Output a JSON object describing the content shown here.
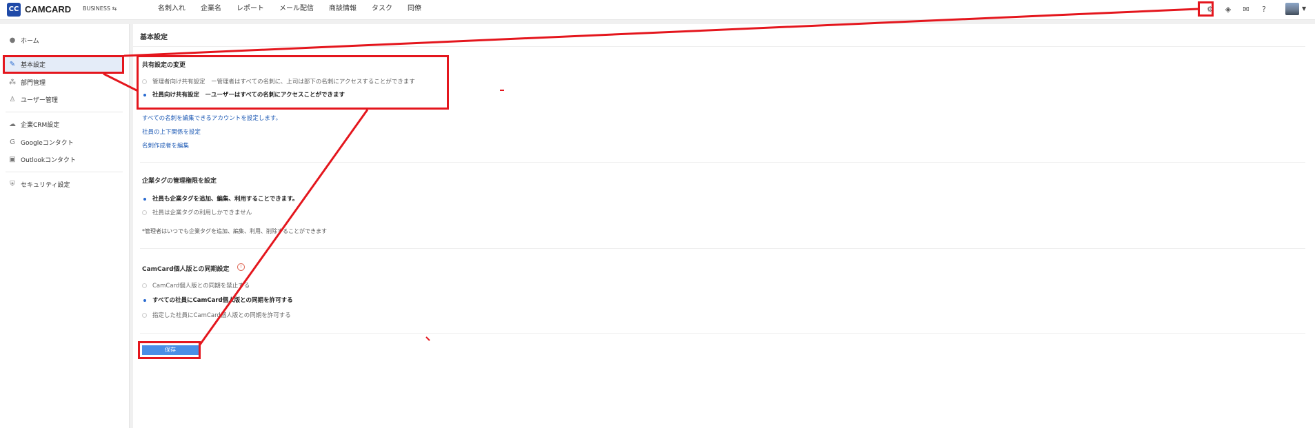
{
  "header": {
    "logo_mark": "CC",
    "logo_text": "CAMCARD",
    "edition": "BUSINESS ⇆",
    "nav": [
      "名刺入れ",
      "企業名",
      "レポート",
      "メール配信",
      "商談情報",
      "タスク",
      "同僚"
    ]
  },
  "sidebar": {
    "items": [
      {
        "label": "ホーム",
        "icon": "info-icon"
      },
      {
        "label": "基本設定",
        "icon": "wrench-icon",
        "active": true
      },
      {
        "label": "部門管理",
        "icon": "org-chart-icon"
      },
      {
        "label": "ユーザー管理",
        "icon": "user-icon"
      },
      {
        "label": "企業CRM設定",
        "icon": "cloud-icon"
      },
      {
        "label": "Googleコンタクト",
        "icon": "google-icon"
      },
      {
        "label": "Outlookコンタクト",
        "icon": "outlook-icon"
      },
      {
        "label": "セキュリティ設定",
        "icon": "shield-icon"
      }
    ]
  },
  "main": {
    "title": "基本設定",
    "sharing": {
      "title": "共有設定の変更",
      "option_admin": "管理者向け共有設定　ー管理者はすべての名刺に、上司は部下の名刺にアクセスすることができます",
      "option_employee": "社員向け共有設定　ーユーザーはすべての名刺にアクセスことができます",
      "selected": "employee",
      "links": [
        "すべての名刺を編集できるアカウントを設定します。",
        "社員の上下関係を設定",
        "名刺作成者を編集"
      ]
    },
    "tags": {
      "title": "企業タグの管理権限を設定",
      "option_allow": "社員も企業タグを追加、編集、利用することできます。",
      "option_deny": "社員は企業タグの利用しかできません",
      "selected": "allow",
      "note": "*管理者はいつでも企業タグを追加、編集、利用、削除することができます"
    },
    "sync": {
      "title": "CamCard個人版との同期設定",
      "option_forbid": "CamCard個人版との同期を禁止する",
      "option_all": "すべての社員にCamCard個人版との同期を許可する",
      "option_some": "指定した社員にCamCard個人版との同期を許可する",
      "selected": "all"
    },
    "save_label": "保存"
  },
  "annotation_color": "#e4161d"
}
